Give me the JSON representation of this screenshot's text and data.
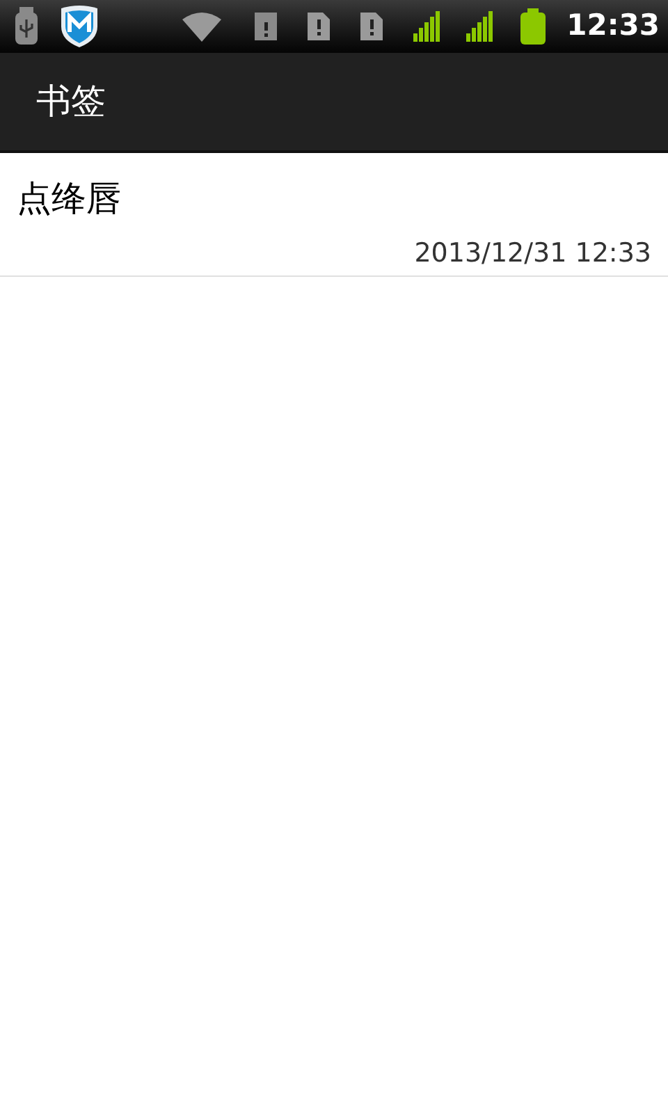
{
  "status_bar": {
    "time": "12:33"
  },
  "action_bar": {
    "title": "书签"
  },
  "bookmarks": [
    {
      "title": "点绛唇",
      "date": "2013/12/31 12:33"
    }
  ]
}
